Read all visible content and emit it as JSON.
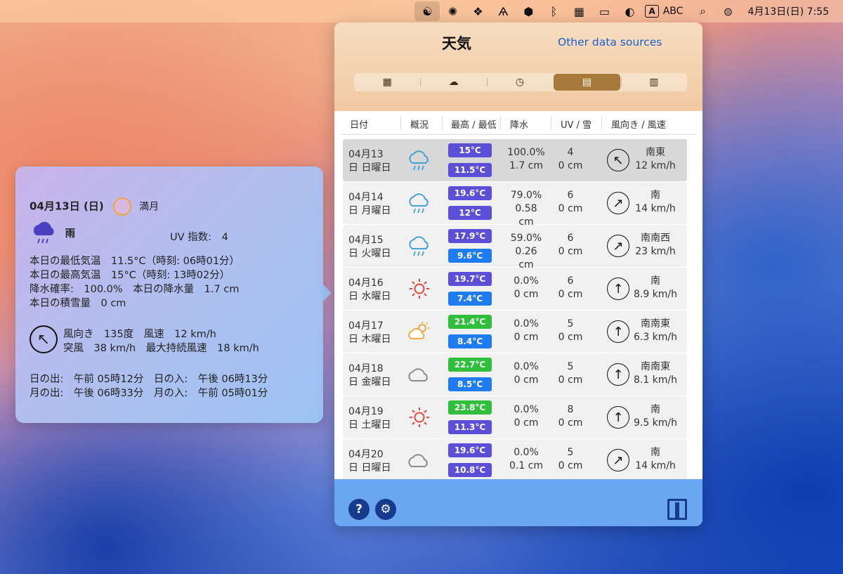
{
  "menubar": {
    "icons": [
      "yin-yang-icon",
      "openai-icon",
      "dropbox-icon",
      "font-icon",
      "hexagon-icon",
      "bluetooth-icon",
      "calendar-grid-icon",
      "battery-icon",
      "contrast-icon",
      "input-method-icon",
      "search-icon",
      "control-center-icon"
    ],
    "input_box": "A",
    "input_label": "ABC",
    "clock": "4月13日(日) 7:55"
  },
  "detail": {
    "date": "04月13日 (日)",
    "moon": "満月",
    "condition": "雨",
    "uv_label": "UV 指数:",
    "uv_value": "4",
    "line1": "本日の最低気温　11.5°C（時刻: 06時01分）",
    "line2": "本日の最高気温　15°C（時刻: 13時02分）",
    "line3": "降水確率:　100.0%　本日の降水量　1.7 cm",
    "line4": "本日の積雪量　0 cm",
    "wind1": "風向き　135度　風速　12 km/h",
    "wind2": "突風　38 km/h　最大持続風速　18 km/h",
    "sun": "日の出:　午前 05時12分　日の入:　午後 06時13分",
    "moonrise": "月の出:　午後 06時33分　月の入:　午前 05時01分"
  },
  "panel": {
    "title": "天気",
    "other_sources": "Other data sources",
    "tabs": [
      {
        "icon": "calendar-icon",
        "glyph": "▦"
      },
      {
        "icon": "partly-cloudy-icon",
        "glyph": "☁"
      },
      {
        "icon": "clock-icon",
        "glyph": "◷"
      },
      {
        "icon": "list-icon",
        "glyph": "▤"
      },
      {
        "icon": "document-icon",
        "glyph": "▥"
      }
    ],
    "headers": [
      "日付",
      "概況",
      "最高 / 最低",
      "降水",
      "UV / 雪",
      "風向き / 風速"
    ]
  },
  "colors": {
    "hi_purple": "#5a4fd6",
    "hi_green": "#2fbf3a",
    "lo_blue": "#1e7cf0"
  },
  "days": [
    {
      "date": "04月13",
      "weekday": "日 日曜日",
      "icon": "rain-icon",
      "hi": "15°C",
      "hi_color": "#5a4fd6",
      "lo": "11.5°C",
      "lo_color": "#5a4fd6",
      "precip_pct": "100.0%",
      "precip_amt": "1.7 cm",
      "precip_extra": "",
      "uv": "4",
      "snow": "0 cm",
      "wdir": "南東",
      "wspeed": "12 km/h",
      "arrow": "↖"
    },
    {
      "date": "04月14",
      "weekday": "日 月曜日",
      "icon": "rain-icon",
      "hi": "19.6°C",
      "hi_color": "#5a4fd6",
      "lo": "12°C",
      "lo_color": "#5a4fd6",
      "precip_pct": "79.0%",
      "precip_amt": "0.58",
      "precip_extra": "cm",
      "uv": "6",
      "snow": "0 cm",
      "wdir": "南",
      "wspeed": "14 km/h",
      "arrow": "↗"
    },
    {
      "date": "04月15",
      "weekday": "日 火曜日",
      "icon": "rain-icon",
      "hi": "17.9°C",
      "hi_color": "#5a4fd6",
      "lo": "9.6°C",
      "lo_color": "#1e7cf0",
      "precip_pct": "59.0%",
      "precip_amt": "0.26",
      "precip_extra": "cm",
      "uv": "6",
      "snow": "0 cm",
      "wdir": "南南西",
      "wspeed": "23 km/h",
      "arrow": "↗"
    },
    {
      "date": "04月16",
      "weekday": "日 水曜日",
      "icon": "sun-icon",
      "hi": "19.7°C",
      "hi_color": "#5a4fd6",
      "lo": "7.4°C",
      "lo_color": "#1e7cf0",
      "precip_pct": "0.0%",
      "precip_amt": "0 cm",
      "precip_extra": "",
      "uv": "6",
      "snow": "0 cm",
      "wdir": "南",
      "wspeed": "8.9 km/h",
      "arrow": "↑"
    },
    {
      "date": "04月17",
      "weekday": "日 木曜日",
      "icon": "partly-cloudy-icon",
      "hi": "21.4°C",
      "hi_color": "#2fbf3a",
      "lo": "8.4°C",
      "lo_color": "#1e7cf0",
      "precip_pct": "0.0%",
      "precip_amt": "0 cm",
      "precip_extra": "",
      "uv": "5",
      "snow": "0 cm",
      "wdir": "南南東",
      "wspeed": "6.3 km/h",
      "arrow": "↑"
    },
    {
      "date": "04月18",
      "weekday": "日 金曜日",
      "icon": "cloud-icon",
      "hi": "22.7°C",
      "hi_color": "#2fbf3a",
      "lo": "8.5°C",
      "lo_color": "#1e7cf0",
      "precip_pct": "0.0%",
      "precip_amt": "0 cm",
      "precip_extra": "",
      "uv": "5",
      "snow": "0 cm",
      "wdir": "南南東",
      "wspeed": "8.1 km/h",
      "arrow": "↑"
    },
    {
      "date": "04月19",
      "weekday": "日 土曜日",
      "icon": "sun-icon",
      "hi": "23.8°C",
      "hi_color": "#2fbf3a",
      "lo": "11.3°C",
      "lo_color": "#5a4fd6",
      "precip_pct": "0.0%",
      "precip_amt": "0 cm",
      "precip_extra": "",
      "uv": "8",
      "snow": "0 cm",
      "wdir": "南",
      "wspeed": "9.5 km/h",
      "arrow": "↑"
    },
    {
      "date": "04月20",
      "weekday": "日 日曜日",
      "icon": "cloud-icon",
      "hi": "19.6°C",
      "hi_color": "#5a4fd6",
      "lo": "10.8°C",
      "lo_color": "#5a4fd6",
      "precip_pct": "0.0%",
      "precip_amt": "0.1 cm",
      "precip_extra": "",
      "uv": "5",
      "snow": "0 cm",
      "wdir": "南",
      "wspeed": "14 km/h",
      "arrow": "↗"
    }
  ],
  "footer": {
    "help": "?",
    "settings_glyph": "⚙"
  }
}
